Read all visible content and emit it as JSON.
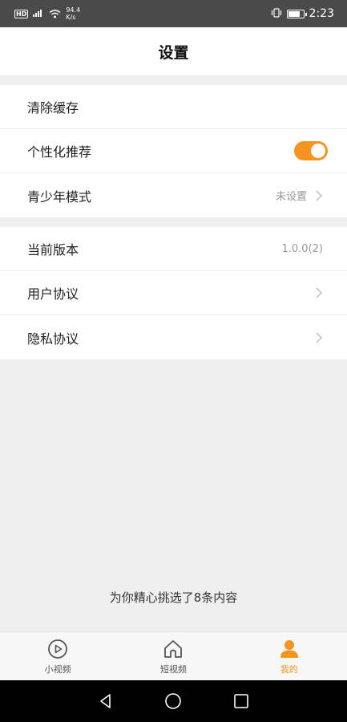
{
  "status_bar": {
    "hd": "HD",
    "signal": "⁴ᴳ",
    "speed_value": "94.4",
    "speed_unit": "K/s",
    "time": "2:23",
    "battery_level": 0.8
  },
  "header": {
    "title": "设置"
  },
  "group1": {
    "clear_cache": "清除缓存",
    "personalized": "个性化推荐",
    "personalized_on": true,
    "teen_mode": "青少年模式",
    "teen_mode_value": "未设置"
  },
  "group2": {
    "version": "当前版本",
    "version_value": "1.0.0(2)",
    "user_agreement": "用户协议",
    "privacy_agreement": "隐私协议"
  },
  "tip": "为你精心挑选了8条内容",
  "tabs": [
    {
      "label": "小视频",
      "icon": "play-circle-icon",
      "active": false
    },
    {
      "label": "短视频",
      "icon": "home-icon",
      "active": false
    },
    {
      "label": "我的",
      "icon": "person-icon",
      "active": true
    }
  ],
  "colors": {
    "accent": "#f59420",
    "chevron": "#c4c4c4"
  }
}
